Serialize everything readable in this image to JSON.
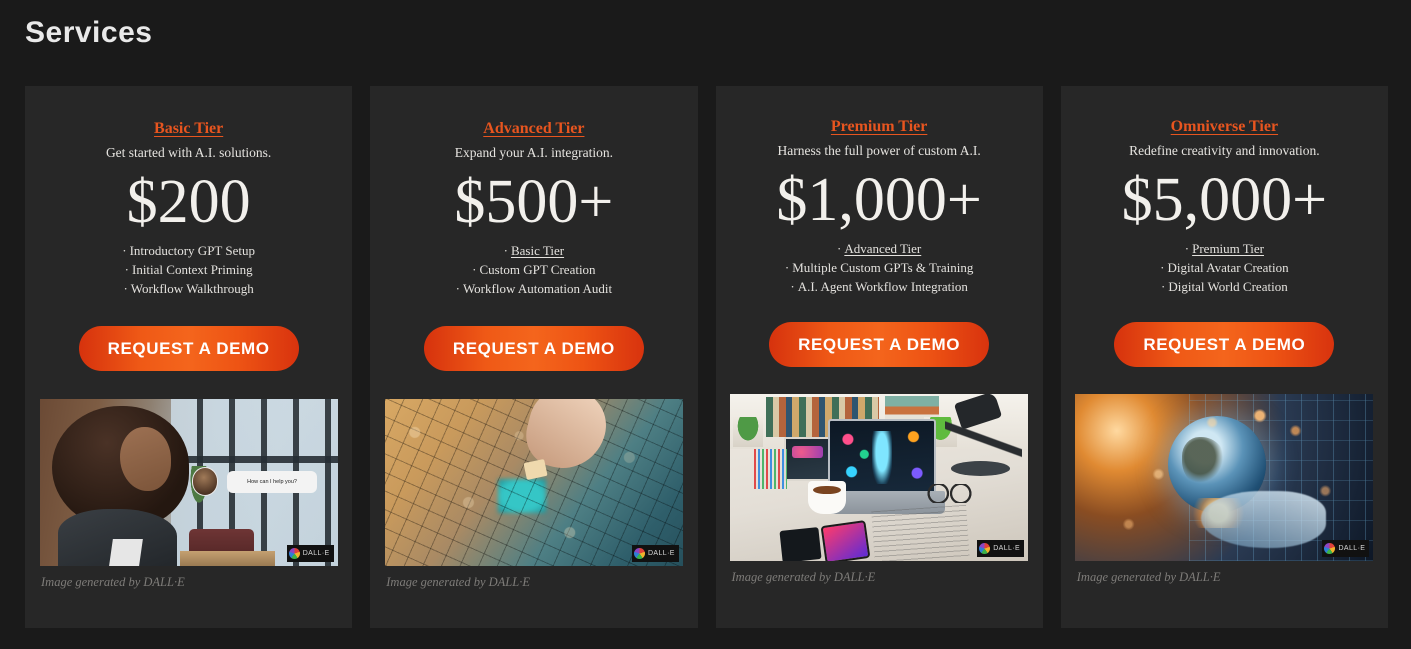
{
  "page": {
    "title": "Services",
    "background_color": "#1a1a1a",
    "card_background_color": "#272727",
    "accent_color": "#e8551f",
    "button_gradient_from": "#d6320d",
    "button_gradient_to": "#f4651c"
  },
  "cards": [
    {
      "tier": "Basic Tier",
      "tagline": "Get started with A.I. solutions.",
      "price": "$200",
      "features": [
        {
          "text": "Introductory GPT Setup",
          "is_link": false
        },
        {
          "text": "Initial Context Priming",
          "is_link": false
        },
        {
          "text": "Workflow Walkthrough",
          "is_link": false
        }
      ],
      "cta": "REQUEST A DEMO",
      "image_alt": "woman-in-office-with-ai-chat-bubble",
      "image_bubble_text": "How can I help you?",
      "watermark": "DALL·E",
      "caption": "Image generated by DALL·E"
    },
    {
      "tier": "Advanced Tier",
      "tagline": "Expand your A.I. integration.",
      "price": "$500+",
      "features": [
        {
          "text": "Basic Tier",
          "is_link": true
        },
        {
          "text": "Custom GPT Creation",
          "is_link": false
        },
        {
          "text": "Workflow Automation Audit",
          "is_link": false
        }
      ],
      "cta": "REQUEST A DEMO",
      "image_alt": "hand-placing-jigsaw-puzzle-piece",
      "watermark": "DALL·E",
      "caption": "Image generated by DALL·E"
    },
    {
      "tier": "Premium Tier",
      "tagline": "Harness the full power of custom A.I.",
      "price": "$1,000+",
      "features": [
        {
          "text": "Advanced Tier",
          "is_link": true
        },
        {
          "text": "Multiple Custom GPTs & Training",
          "is_link": false
        },
        {
          "text": "A.I. Agent Workflow Integration",
          "is_link": false
        }
      ],
      "cta": "REQUEST A DEMO",
      "image_alt": "modern-desk-workspace-with-ai-laptop",
      "watermark": "DALL·E",
      "caption": "Image generated by DALL·E"
    },
    {
      "tier": "Omniverse Tier",
      "tagline": "Redefine creativity and innovation.",
      "price": "$5,000+",
      "features": [
        {
          "text": "Premium Tier",
          "is_link": true
        },
        {
          "text": "Digital Avatar Creation",
          "is_link": false
        },
        {
          "text": "Digital World Creation",
          "is_link": false
        }
      ],
      "cta": "REQUEST A DEMO",
      "image_alt": "robotic-hand-holding-digital-globe",
      "watermark": "DALL·E",
      "caption": "Image generated by DALL·E"
    }
  ],
  "bullet_glyph": "·"
}
